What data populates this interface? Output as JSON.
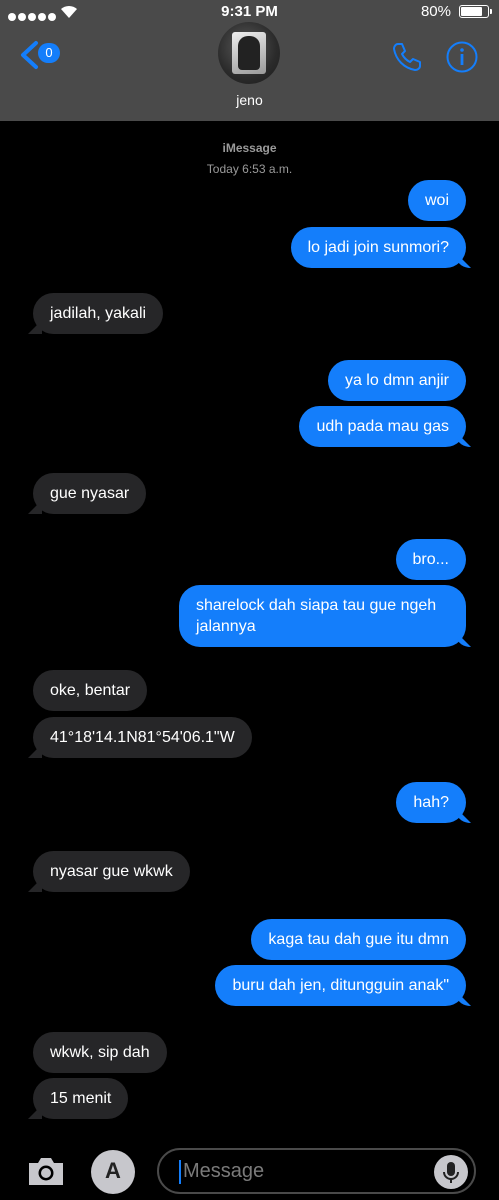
{
  "status_bar": {
    "time": "9:31 PM",
    "battery": "80%",
    "battery_level": 0.8
  },
  "header": {
    "back_badge": "0",
    "contact_name": "jeno"
  },
  "thread": {
    "service": "iMessage",
    "timestamp": "Today 6:53 a.m."
  },
  "messages": [
    {
      "from": "me",
      "text": "woi"
    },
    {
      "from": "me",
      "text": "lo jadi join sunmori?"
    },
    {
      "from": "them",
      "text": "jadilah, yakali"
    },
    {
      "from": "me",
      "text": "ya lo dmn anjir"
    },
    {
      "from": "me",
      "text": "udh pada mau gas"
    },
    {
      "from": "them",
      "text": "gue nyasar"
    },
    {
      "from": "me",
      "text": "bro..."
    },
    {
      "from": "me",
      "text": "sharelock dah siapa tau gue ngeh jalannya"
    },
    {
      "from": "them",
      "text": "oke, bentar"
    },
    {
      "from": "them",
      "text": "41°18'14.1N81°54'06.1\"W"
    },
    {
      "from": "me",
      "text": "hah?"
    },
    {
      "from": "them",
      "text": "nyasar gue wkwk"
    },
    {
      "from": "me",
      "text": "kaga tau dah gue itu dmn"
    },
    {
      "from": "me",
      "text": "buru dah jen, ditungguin anak\""
    },
    {
      "from": "them",
      "text": "wkwk, sip dah"
    },
    {
      "from": "them",
      "text": "15 menit"
    }
  ],
  "composer": {
    "placeholder": "Message"
  }
}
